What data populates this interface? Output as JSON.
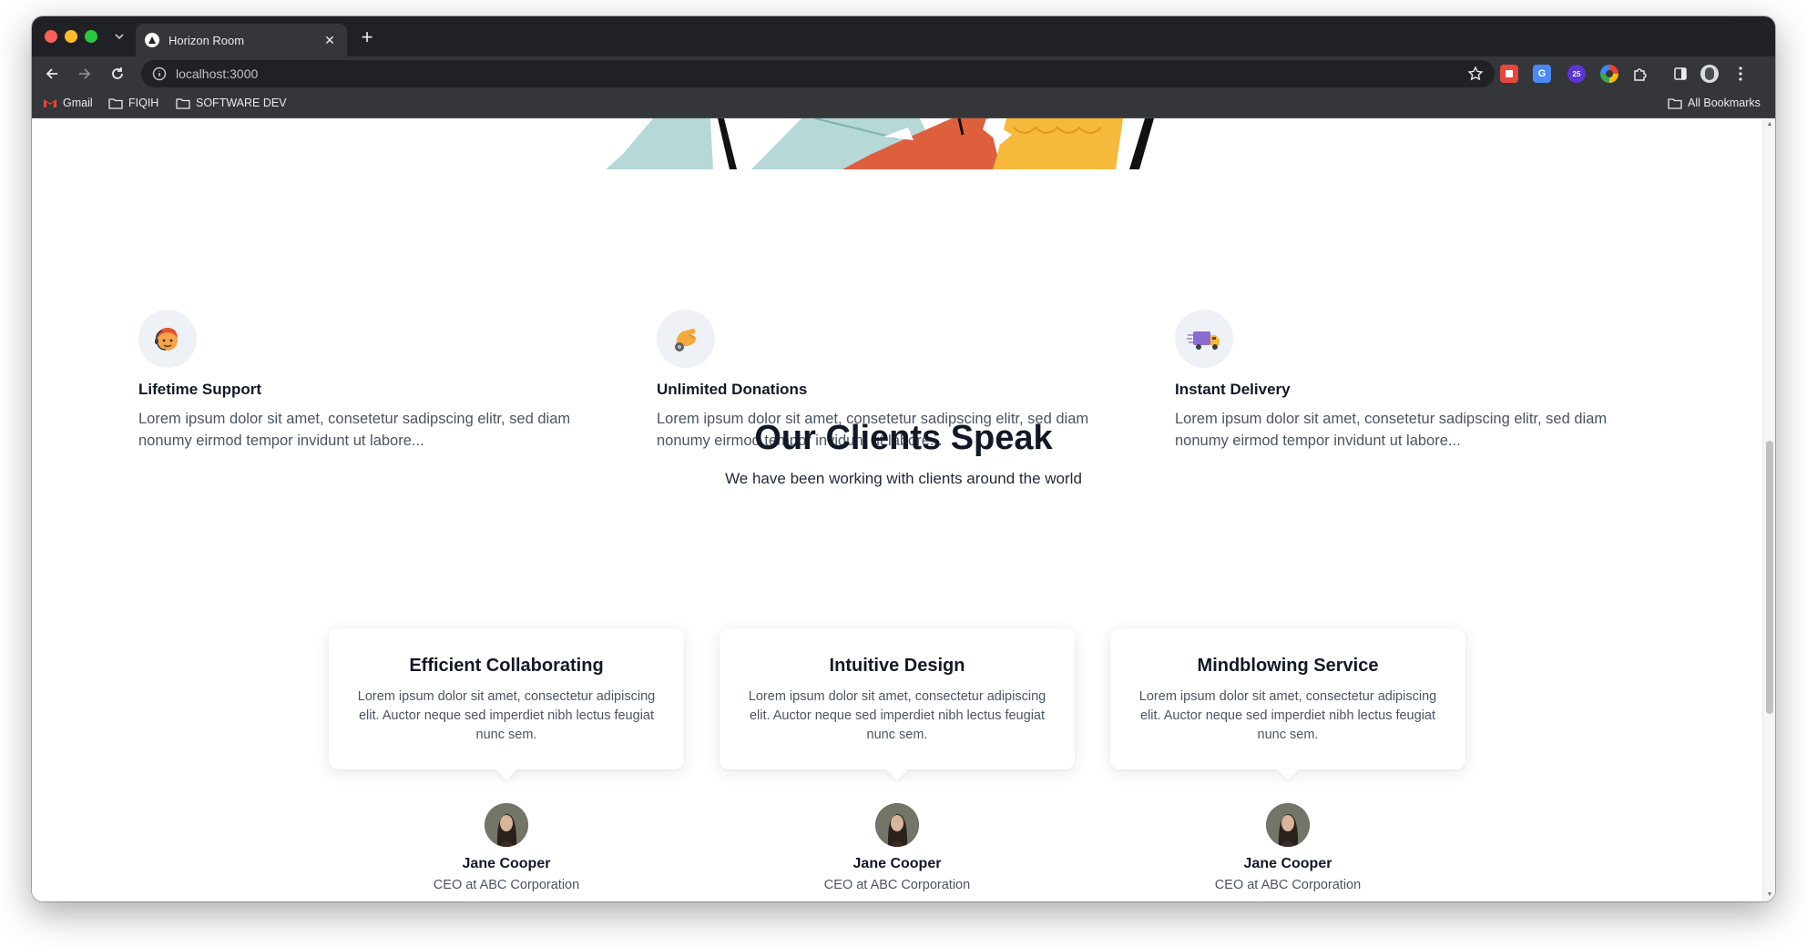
{
  "browser": {
    "tab_title": "Horizon Room",
    "url": "localhost:3000",
    "bookmarks": [
      {
        "label": "Gmail"
      },
      {
        "label": "FIQIH"
      },
      {
        "label": "SOFTWARE DEV"
      }
    ],
    "all_bookmarks_label": "All Bookmarks",
    "extension_badge": "25"
  },
  "features": [
    {
      "title": "Lifetime Support",
      "description": "Lorem ipsum dolor sit amet, consetetur sadipscing elitr, sed diam nonumy eirmod tempor invidunt ut labore...",
      "icon": "support-agent-icon"
    },
    {
      "title": "Unlimited Donations",
      "description": "Lorem ipsum dolor sit amet, consetetur sadipscing elitr, sed diam nonumy eirmod tempor invidunt ut labore...",
      "icon": "donation-hand-icon"
    },
    {
      "title": "Instant Delivery",
      "description": "Lorem ipsum dolor sit amet, consetetur sadipscing elitr, sed diam nonumy eirmod tempor invidunt ut labore...",
      "icon": "delivery-truck-icon"
    }
  ],
  "clients": {
    "title": "Our Clients Speak",
    "subtitle": "We have been working with clients around the world",
    "testimonials": [
      {
        "title": "Efficient Collaborating",
        "text": "Lorem ipsum dolor sit amet, consectetur adipiscing elit. Auctor neque sed imperdiet nibh lectus feugiat nunc sem.",
        "name": "Jane Cooper",
        "role": "CEO at ABC Corporation"
      },
      {
        "title": "Intuitive Design",
        "text": "Lorem ipsum dolor sit amet, consectetur adipiscing elit. Auctor neque sed imperdiet nibh lectus feugiat nunc sem.",
        "name": "Jane Cooper",
        "role": "CEO at ABC Corporation"
      },
      {
        "title": "Mindblowing Service",
        "text": "Lorem ipsum dolor sit amet, consectetur adipiscing elit. Auctor neque sed imperdiet nibh lectus feugiat nunc sem.",
        "name": "Jane Cooper",
        "role": "CEO at ABC Corporation"
      }
    ]
  },
  "colors": {
    "heading": "#111827",
    "body_text": "#4b5563",
    "icon_bg": "#eef1f6",
    "browser_chrome": "#35363a"
  }
}
